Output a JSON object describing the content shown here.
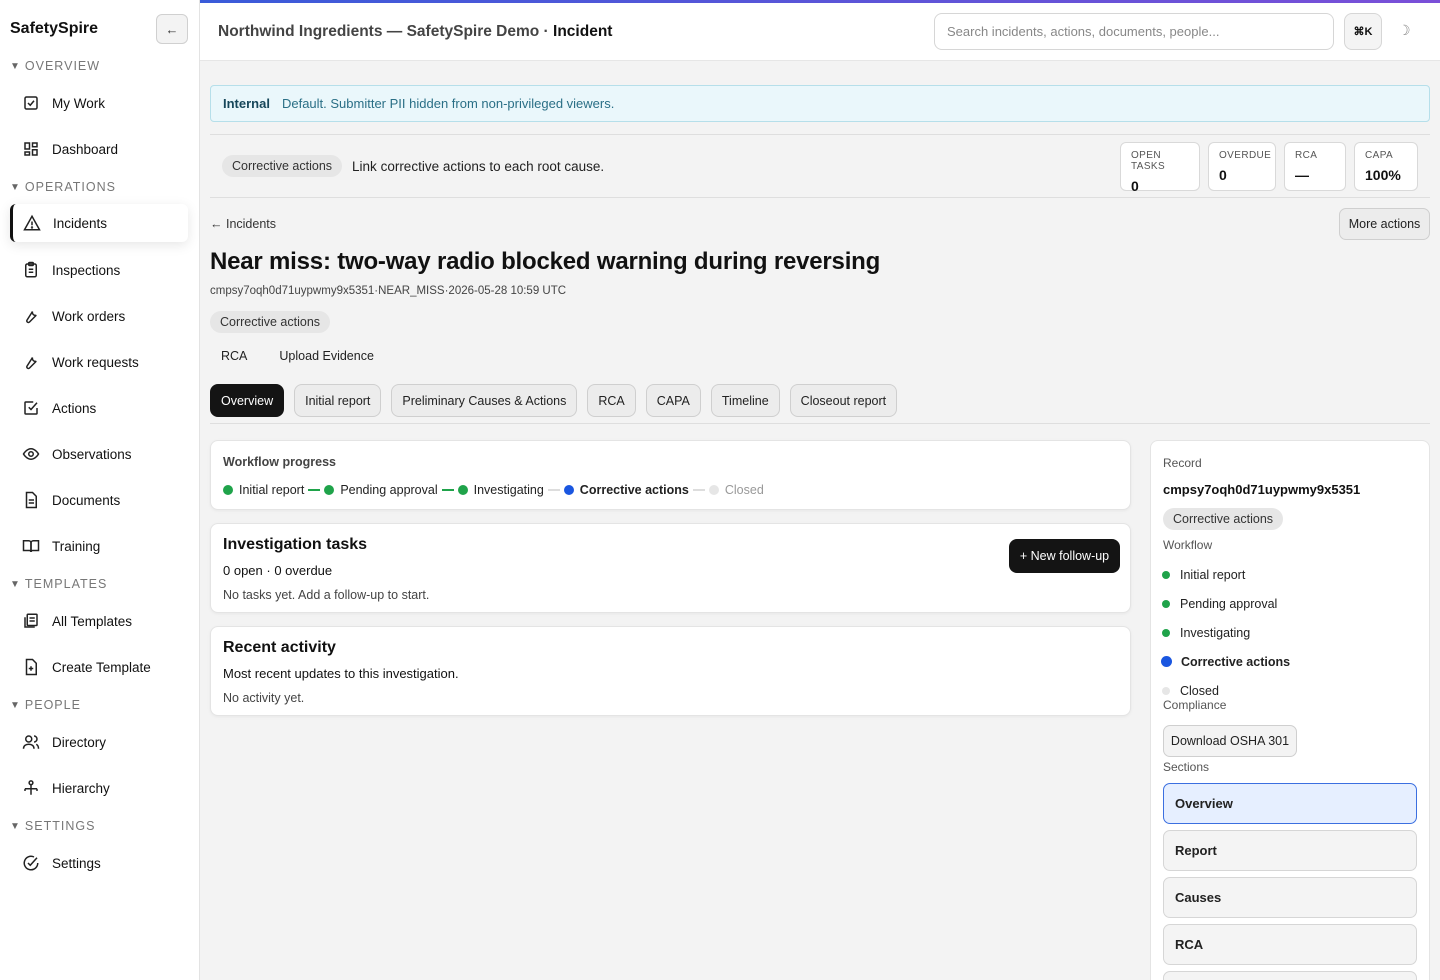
{
  "sidebar": {
    "brand": "SafetySpire",
    "collapse_label": "←",
    "sections": {
      "overview": "OVERVIEW",
      "operations": "OPERATIONS",
      "templates": "TEMPLATES",
      "people": "PEOPLE",
      "settings": "SETTINGS"
    },
    "items": {
      "my_work": "My Work",
      "dashboard": "Dashboard",
      "incidents": "Incidents",
      "inspections": "Inspections",
      "work_orders": "Work orders",
      "work_requests": "Work requests",
      "actions": "Actions",
      "observations": "Observations",
      "documents": "Documents",
      "training": "Training",
      "all_templates": "All Templates",
      "create_template": "Create Template",
      "directory": "Directory",
      "hierarchy": "Hierarchy",
      "settings": "Settings"
    },
    "active_item": "Incidents"
  },
  "header": {
    "org": "Northwind Ingredients — SafetySpire Demo",
    "separator": " · ",
    "page": "Incident",
    "search_placeholder": "Search incidents, actions, documents, people...",
    "shortcut": "⌘K",
    "theme_icon": "☽"
  },
  "banner": {
    "label": "Internal",
    "text": "Default. Submitter PII hidden from non-privileged viewers."
  },
  "strip": {
    "chip": "Corrective actions",
    "text": "Link corrective actions to each root cause.",
    "stats": [
      {
        "label": "OPEN TASKS",
        "value": "0"
      },
      {
        "label": "OVERDUE",
        "value": "0"
      },
      {
        "label": "RCA",
        "value": "—"
      },
      {
        "label": "CAPA",
        "value": "100%"
      }
    ]
  },
  "incident": {
    "back": "← Incidents",
    "more_actions": "More actions",
    "title": "Near miss: two-way radio blocked warning during reversing",
    "meta": "cmpsy7oqh0d71uypwmy9x5351·NEAR_MISS·2026-05-28 10:59 UTC",
    "status": "Corrective actions",
    "sub_actions": [
      "RCA",
      "Upload Evidence"
    ],
    "tabs": [
      "Overview",
      "Initial report",
      "Preliminary Causes & Actions",
      "RCA",
      "CAPA",
      "Timeline",
      "Closeout report"
    ],
    "active_tab": "Overview"
  },
  "workflow": {
    "title": "Workflow progress",
    "steps": [
      {
        "label": "Initial report",
        "state": "done"
      },
      {
        "label": "Pending approval",
        "state": "done"
      },
      {
        "label": "Investigating",
        "state": "done"
      },
      {
        "label": "Corrective actions",
        "state": "current"
      },
      {
        "label": "Closed",
        "state": "future"
      }
    ]
  },
  "tasks": {
    "title": "Investigation tasks",
    "summary": "0 open · 0 overdue",
    "empty": "No tasks yet. Add a follow-up to start.",
    "new_button": "+ New follow-up"
  },
  "activity": {
    "title": "Recent activity",
    "subtitle": "Most recent updates to this investigation.",
    "empty": "No activity yet."
  },
  "record": {
    "label": "Record",
    "id": "cmpsy7oqh0d71uypwmy9x5351",
    "status": "Corrective actions",
    "workflow_label": "Workflow",
    "compliance_label": "Compliance",
    "osha_button": "Download OSHA 301",
    "sections_label": "Sections",
    "sections": [
      "Overview",
      "Report",
      "Causes",
      "RCA"
    ]
  },
  "colors": {
    "done": "#1fa34a",
    "current": "#1a56e0",
    "future": "#e6e6e6",
    "accent": "#3a5bd9"
  }
}
